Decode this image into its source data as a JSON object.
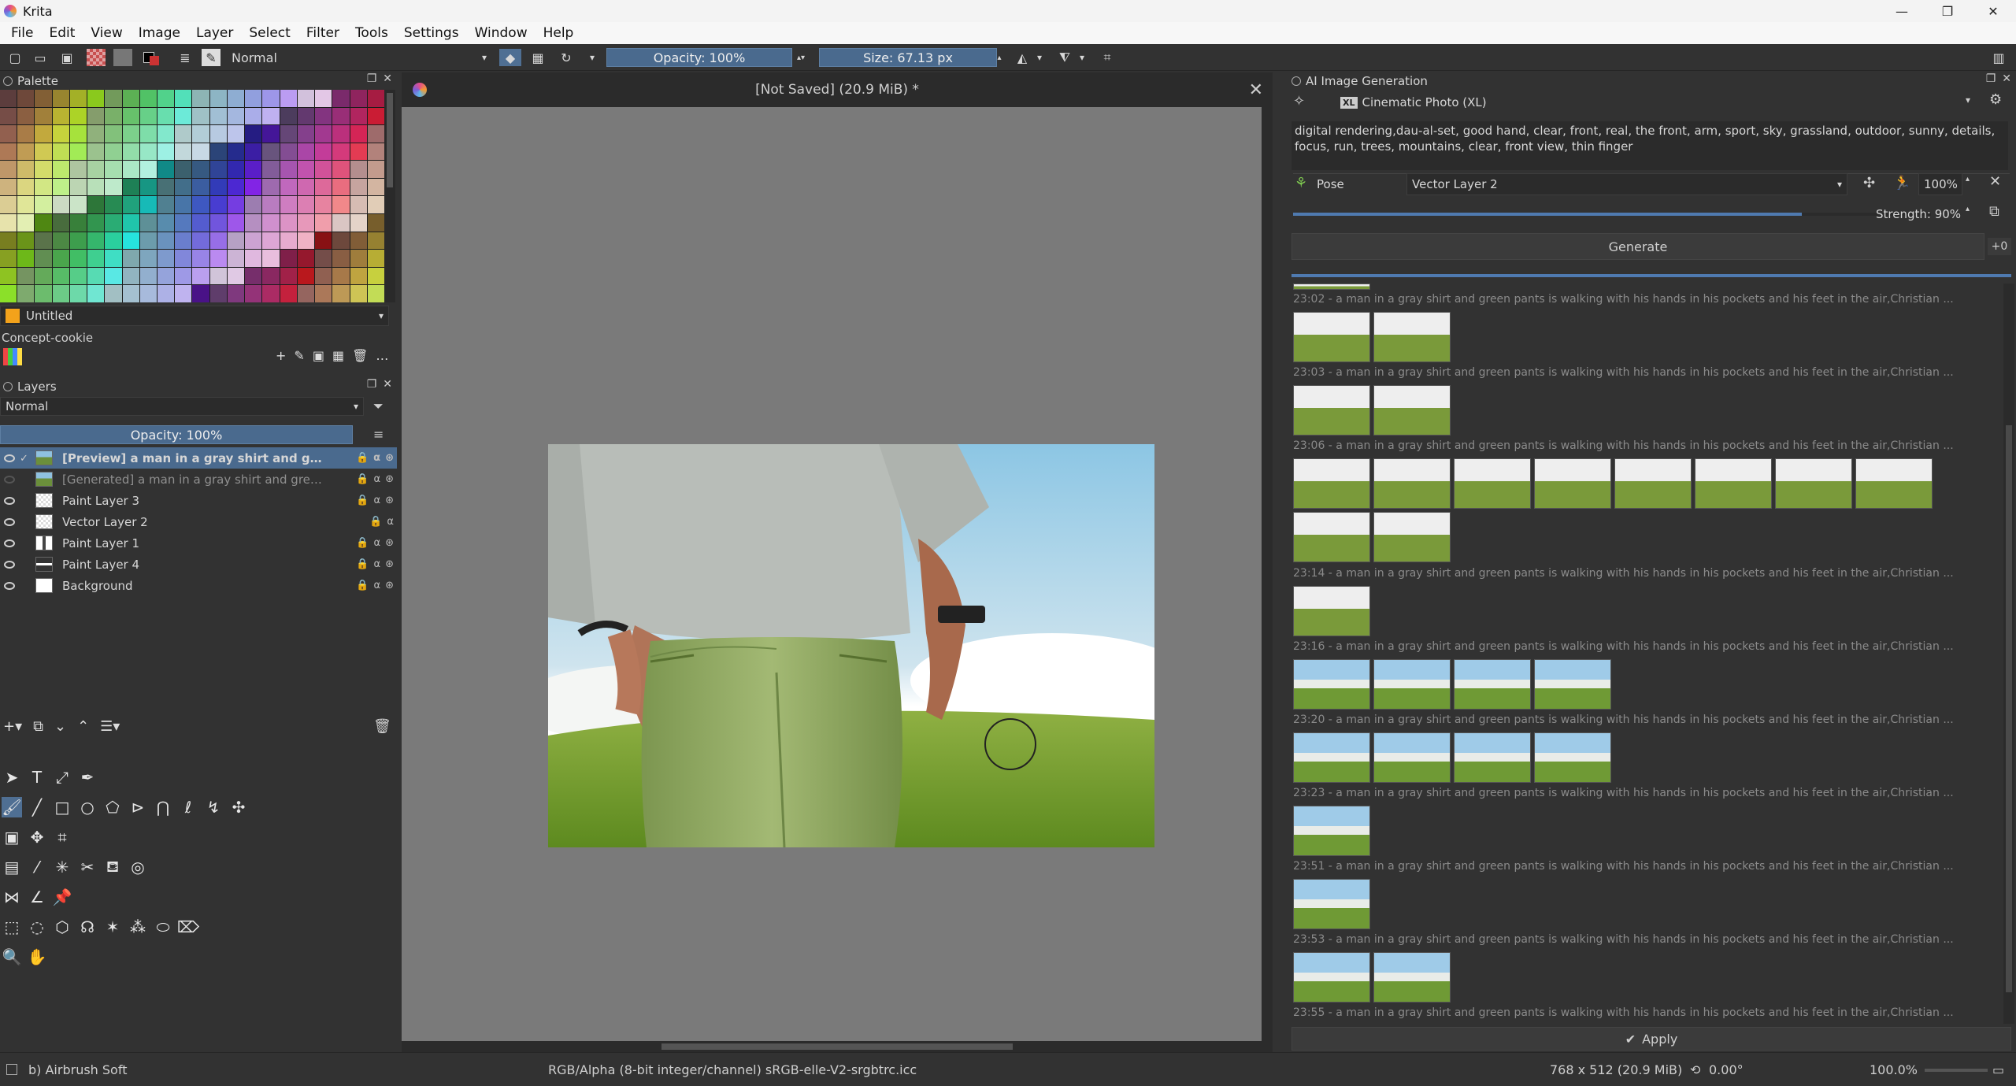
{
  "window": {
    "title": "Krita",
    "min": "—",
    "max": "❐",
    "close": "✕"
  },
  "menu": [
    "File",
    "Edit",
    "View",
    "Image",
    "Layer",
    "Select",
    "Filter",
    "Tools",
    "Settings",
    "Window",
    "Help"
  ],
  "toolbar": {
    "blend_mode": "Normal",
    "opacity": "Opacity: 100%",
    "size": "Size: 67.13 px"
  },
  "palette_panel": {
    "title": "Palette",
    "palette_name": "Untitled",
    "set_name": "Concept-cookie"
  },
  "layers_panel": {
    "title": "Layers",
    "blend_mode": "Normal",
    "opacity": "Opacity:  100%",
    "layers": [
      {
        "name": "[Preview] a man in a gray shirt and green pants ..."
      },
      {
        "name": "[Generated] a man in a gray shirt and green pants..."
      },
      {
        "name": "Paint Layer 3"
      },
      {
        "name": "Vector Layer 2"
      },
      {
        "name": "Paint Layer 1"
      },
      {
        "name": "Paint Layer 4"
      },
      {
        "name": "Background"
      }
    ]
  },
  "canvas": {
    "tab_title": "[Not Saved]  (20.9 MiB) *"
  },
  "ai_panel": {
    "title": "AI Image Generation",
    "model": "Cinematic Photo (XL)",
    "prompt": "digital rendering,dau-al-set, good hand, clear, front, real, the front, arm, sport, sky, grassland, outdoor, sunny, details, focus, run, trees, mountains, clear, front view, thin finger",
    "control_type": "Pose",
    "control_layer": "Vector Layer 2",
    "control_strength": "100%",
    "strength": "Strength: 90%",
    "generate_label": "Generate",
    "seed_badge": "+0",
    "apply_label": "Apply",
    "history": [
      {
        "time": "23:02 - a man in a gray shirt and green pants is walking with his hands in his pockets and his feet in the air,Christian ...",
        "count": 2
      },
      {
        "time": "23:03 - a man in a gray shirt and green pants is walking with his hands in his pockets and his feet in the air,Christian ...",
        "count": 2
      },
      {
        "time": "23:06 - a man in a gray shirt and green pants is walking with his hands in his pockets and his feet in the air,Christian ...",
        "count": 8
      },
      {
        "time": "23:14 - a man in a gray shirt and green pants is walking with his hands in his pockets and his feet in the air,Christian ...",
        "count": 1
      },
      {
        "time": "23:16 - a man in a gray shirt and green pants is walking with his hands in his pockets and his feet in the air,Christian ...",
        "count": 4
      },
      {
        "time": "23:20 - a man in a gray shirt and green pants is walking with his hands in his pockets and his feet in the air,Christian ...",
        "count": 4
      },
      {
        "time": "23:23 - a man in a gray shirt and green pants is walking with his hands in his pockets and his feet in the air,Christian ...",
        "count": 1
      },
      {
        "time": "23:51 - a man in a gray shirt and green pants is walking with his hands in his pockets and his feet in the air,Christian ...",
        "count": 1
      },
      {
        "time": "23:53 - a man in a gray shirt and green pants is walking with his hands in his pockets and his feet in the air,Christian ...",
        "count": 2
      },
      {
        "time": "23:55 - a man in a gray shirt and green pants is walking with his hands in his pockets and his feet in the air,Christian ...",
        "count": 0
      }
    ]
  },
  "status": {
    "brush": "b) Airbrush Soft",
    "color_profile": "RGB/Alpha (8-bit integer/channel)  sRGB-elle-V2-srgbtrc.icc",
    "dimensions": "768 x 512 (20.9 MiB)",
    "rotation": "0.00°",
    "zoom": "100.0%"
  }
}
